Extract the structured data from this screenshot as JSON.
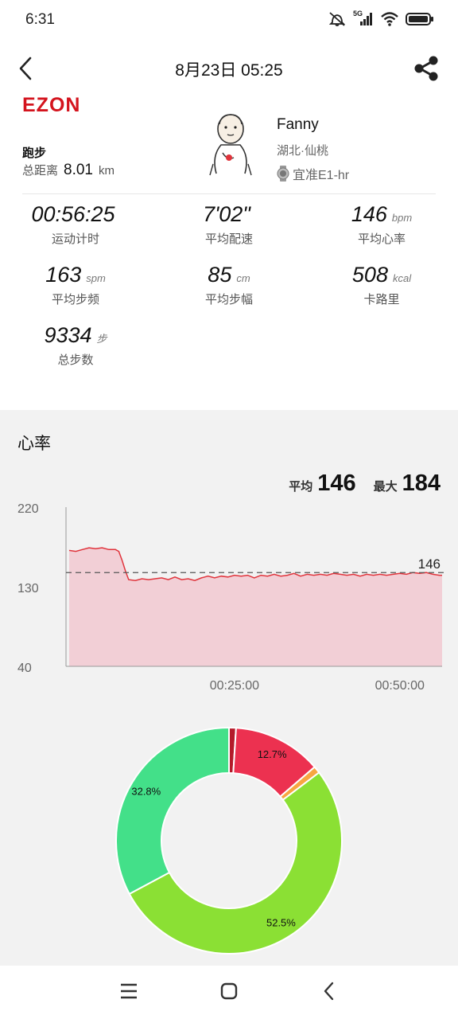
{
  "status_bar": {
    "time": "6:31",
    "network": "5G"
  },
  "header": {
    "title": "8月23日 05:25"
  },
  "activity": {
    "brand": "EZON",
    "type": "跑步",
    "distance_label": "总距离",
    "distance_value": "8.01",
    "distance_unit": "km"
  },
  "user": {
    "name": "Fanny",
    "location": "湖北·仙桃",
    "device": "宜准E1-hr"
  },
  "metrics": [
    {
      "value": "00:56:25",
      "unit": "",
      "label": "运动计时"
    },
    {
      "value": "7'02\"",
      "unit": "",
      "label": "平均配速"
    },
    {
      "value": "146",
      "unit": "bpm",
      "label": "平均心率"
    },
    {
      "value": "163",
      "unit": "spm",
      "label": "平均步频"
    },
    {
      "value": "85",
      "unit": "cm",
      "label": "平均步幅"
    },
    {
      "value": "508",
      "unit": "kcal",
      "label": "卡路里"
    },
    {
      "value": "9334",
      "unit": "步",
      "label": "总步数"
    }
  ],
  "heart_rate": {
    "section_title": "心率",
    "avg_label": "平均",
    "avg_value": "146",
    "max_label": "最大",
    "max_value": "184"
  },
  "chart_data": [
    {
      "type": "area",
      "ylim": [
        40,
        220
      ],
      "yticks": [
        "220",
        "130",
        "40"
      ],
      "xticks": [
        "00:25:00",
        "00:50:00"
      ],
      "xlim_minutes": [
        0,
        56.4
      ],
      "reference_line": {
        "value": 146,
        "label": "146"
      },
      "color": "#e0343c",
      "fill": "#f2cfd6",
      "x_minutes": [
        0,
        1,
        2,
        3,
        4,
        5,
        6,
        7,
        7.5,
        8,
        8.5,
        9,
        10,
        11,
        12,
        13,
        14,
        15,
        16,
        17,
        18,
        19,
        20,
        21,
        22,
        23,
        24,
        25,
        26,
        27,
        28,
        29,
        30,
        31,
        32,
        33,
        34,
        35,
        36,
        37,
        38,
        39,
        40,
        41,
        42,
        43,
        44,
        45,
        46,
        47,
        48,
        49,
        50,
        51,
        52,
        53,
        54,
        55,
        56,
        56.4
      ],
      "y_bpm": [
        171,
        170,
        172,
        174,
        173,
        174,
        172,
        172,
        170,
        160,
        148,
        138,
        137,
        139,
        138,
        139,
        140,
        138,
        141,
        138,
        139,
        137,
        140,
        142,
        140,
        142,
        141,
        143,
        142,
        143,
        140,
        143,
        142,
        144,
        142,
        143,
        145,
        142,
        144,
        143,
        144,
        143,
        145,
        144,
        143,
        144,
        142,
        144,
        143,
        144,
        143,
        144,
        145,
        144,
        146,
        145,
        146,
        144,
        143,
        143
      ]
    },
    {
      "type": "pie",
      "labels": [
        "",
        "12.7%",
        "",
        "52.5%",
        "32.8%"
      ],
      "values": [
        1.0,
        12.7,
        1.0,
        52.5,
        32.8
      ],
      "colors": [
        "#b41a2a",
        "#ec3150",
        "#f7a641",
        "#8be034",
        "#43e089"
      ]
    }
  ],
  "colors": {
    "brand": "#d4141e",
    "chart_line": "#e0343c",
    "chart_fill": "#f2cfd6"
  }
}
